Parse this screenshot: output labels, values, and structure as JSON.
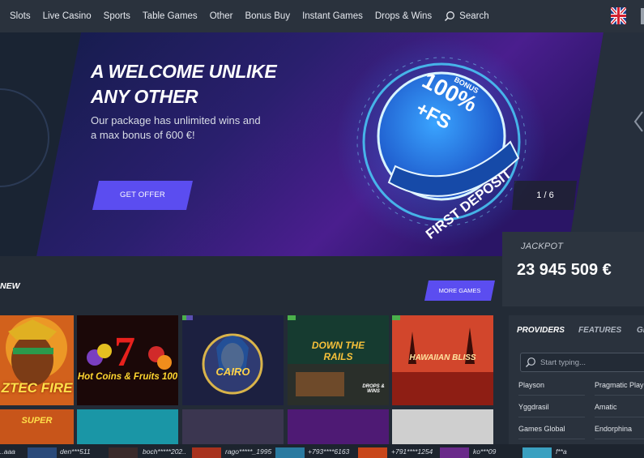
{
  "nav": {
    "items": [
      "Slots",
      "Live Casino",
      "Sports",
      "Table Games",
      "Other",
      "Bonus Buy",
      "Instant Games",
      "Drops & Wins"
    ],
    "search_label": "Search"
  },
  "hero": {
    "title": "A WELCOME UNLIKE ANY OTHER",
    "subtitle": "Our package has unlimited wins and a max bonus of 600 €!",
    "cta_label": "GET OFFER",
    "slide_counter": "1 / 6",
    "badge": {
      "small": "BONUS",
      "big": "100%",
      "plus": "+FS",
      "ribbon": "FIRST DEPOSIT"
    }
  },
  "jackpot": {
    "label": "JACKPOT",
    "value": "23 945 509 €"
  },
  "section": {
    "title": "NEW",
    "more_label": "MORE GAMES"
  },
  "games": [
    {
      "title": "ZTEC FIRE",
      "colors": [
        "#c8561a",
        "#f0a422"
      ]
    },
    {
      "title": "Hot Coins & Fruits 100",
      "colors": [
        "#160707",
        "#3a0d0a"
      ]
    },
    {
      "title": "CAIRO",
      "colors": [
        "#1a1e3c",
        "#3a2f64"
      ]
    },
    {
      "title": "DOWN THE RAILS",
      "colors": [
        "#0f2b24",
        "#1f4a3a"
      ],
      "badge": "DROPS & WINS"
    },
    {
      "title": "HAWAIIAN BLISS",
      "colors": [
        "#8e2214",
        "#d94b2d"
      ]
    }
  ],
  "games_row2": [
    {
      "title": "SUPER",
      "colors": [
        "#c04a12",
        "#e8721c"
      ]
    },
    {
      "title": "",
      "colors": [
        "#127e90",
        "#1aa3b2"
      ]
    },
    {
      "title": "",
      "colors": [
        "#2d2a3e",
        "#4b4360"
      ]
    },
    {
      "title": "",
      "colors": [
        "#3b1256",
        "#60208a"
      ]
    },
    {
      "title": "",
      "colors": [
        "#d9d9d9",
        "#8a8a8a"
      ]
    }
  ],
  "panel": {
    "tabs": [
      "PROVIDERS",
      "FEATURES",
      "GE"
    ],
    "search_placeholder": "Start typing...",
    "providers": [
      [
        "Playson",
        "Pragmatic Play"
      ],
      [
        "Yggdrasil",
        "Amatic"
      ],
      [
        "Games Global",
        "Endorphina"
      ]
    ]
  },
  "ticker": [
    "..aaa",
    "den***511",
    "boch*****202..",
    "rago*****_1995",
    "+793****6163",
    "+791****1254",
    "ko***09",
    "f**a"
  ],
  "colors": {
    "accent": "#5b4df0",
    "nav_bg": "#2a323d",
    "page_bg": "#232b36"
  }
}
